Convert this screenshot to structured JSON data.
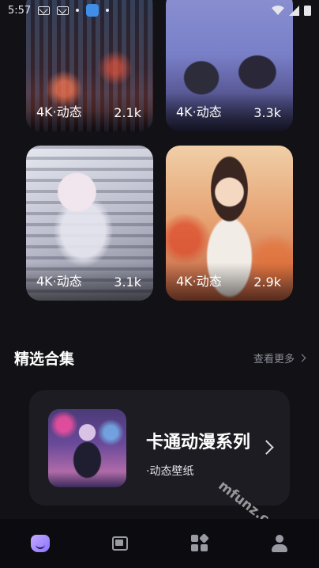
{
  "status_bar": {
    "time": "5:57"
  },
  "wallpapers": [
    {
      "resolution": "4K·动态",
      "count": "2.1k"
    },
    {
      "resolution": "4K·动态",
      "count": "3.3k"
    },
    {
      "resolution": "4K·动态",
      "count": "3.1k"
    },
    {
      "resolution": "4K·动态",
      "count": "2.9k"
    }
  ],
  "featured": {
    "title": "精选合集",
    "view_more": "查看更多"
  },
  "collection": {
    "title": "卡通动漫系列",
    "subtitle": "·动态壁纸"
  },
  "watermark": "mfunz.com 魔趣网",
  "bottom_nav": {
    "items": [
      "home",
      "wallpapers",
      "categories",
      "profile"
    ],
    "active": "home"
  },
  "colors": {
    "background": "#121216",
    "card_background": "#1c1c22",
    "accent": "#a58cff",
    "muted_text": "#8c8c96"
  }
}
